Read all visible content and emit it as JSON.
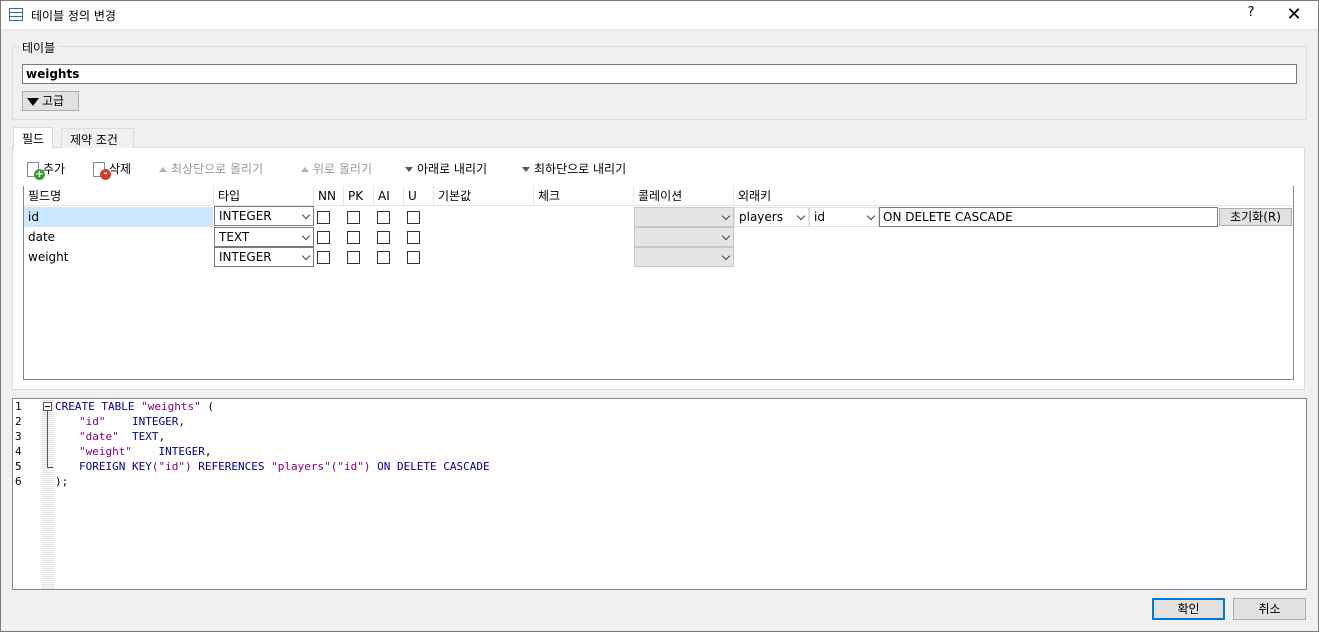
{
  "window": {
    "title": "테이블 정의 변경",
    "help_label": "?",
    "close_label": "✕"
  },
  "table_group": {
    "label": "테이블",
    "name_value": "weights",
    "advanced_label": "고급"
  },
  "tabs": [
    {
      "label": "필드",
      "active": true
    },
    {
      "label": "제약 조건",
      "active": false
    }
  ],
  "toolbar": {
    "add": "추가",
    "delete": "삭제",
    "move_top": "최상단으로 올리기",
    "move_up": "위로 올리기",
    "move_down": "아래로 내리기",
    "move_bottom": "최하단으로 내리기"
  },
  "grid": {
    "headers": [
      "필드명",
      "타입",
      "NN",
      "PK",
      "AI",
      "U",
      "기본값",
      "체크",
      "콜레이션",
      "외래키"
    ],
    "rows": [
      {
        "name": "id",
        "type": "INTEGER",
        "nn": false,
        "pk": false,
        "ai": false,
        "u": false,
        "collation": "",
        "fk_table": "players",
        "fk_column": "id",
        "fk_clause": "ON DELETE CASCADE",
        "fk_reset": "초기화(R)",
        "selected": true
      },
      {
        "name": "date",
        "type": "TEXT",
        "nn": false,
        "pk": false,
        "ai": false,
        "u": false,
        "collation": ""
      },
      {
        "name": "weight",
        "type": "INTEGER",
        "nn": false,
        "pk": false,
        "ai": false,
        "u": false,
        "collation": ""
      }
    ]
  },
  "sql": {
    "line_numbers": [
      "1",
      "2",
      "3",
      "4",
      "5",
      "6"
    ],
    "l1_kw": "CREATE TABLE ",
    "l1_str": "\"weights\"",
    "l1_rest": " (",
    "l2_str": "\"id\"",
    "l2_kw": "INTEGER",
    "l2_rest": ",",
    "l3_str": "\"date\"",
    "l3_kw": "TEXT",
    "l3_rest": ",",
    "l4_str": "\"weight\"",
    "l4_kw": "INTEGER",
    "l4_rest": ",",
    "l5_kw1": "FOREIGN KEY",
    "l5_str1": "(\"id\")",
    "l5_kw2": " REFERENCES ",
    "l5_str2": "\"players\"",
    "l5_str3": "(\"id\")",
    "l5_kw3": " ON DELETE CASCADE",
    "l6": ");"
  },
  "buttons": {
    "ok": "확인",
    "cancel": "취소"
  }
}
